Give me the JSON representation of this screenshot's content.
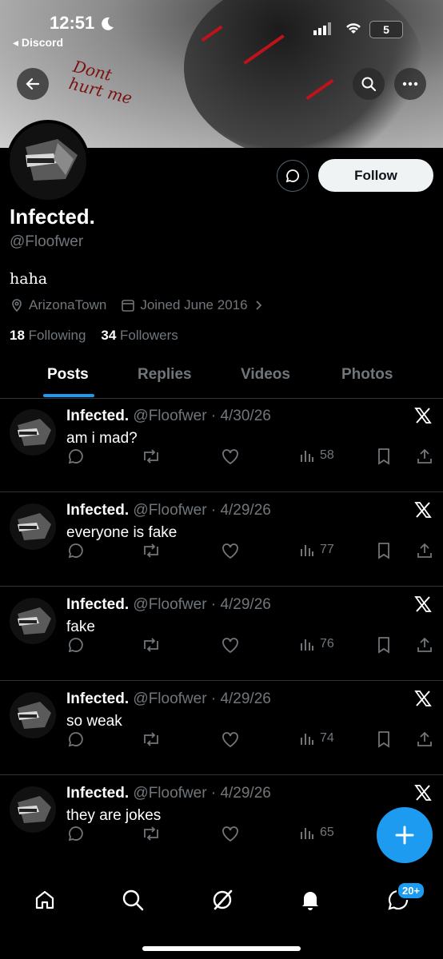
{
  "status_bar": {
    "time": "12:51",
    "back_app": "◂ Discord",
    "battery": "5"
  },
  "banner": {
    "caption": "Dont hurt me"
  },
  "profile": {
    "name": "Infected.",
    "handle": "@Floofwer",
    "bio": "haha",
    "location": "ArizonaTown",
    "joined": "Joined June 2016",
    "following_count": "18",
    "following_label": "Following",
    "followers_count": "34",
    "followers_label": "Followers",
    "follow_button": "Follow"
  },
  "tabs": [
    "Posts",
    "Replies",
    "Videos",
    "Photos"
  ],
  "active_tab": "Posts",
  "posts": [
    {
      "name": "Infected.",
      "handle": "@Floofwer",
      "date": "· 4/30/26",
      "text": "am i mad?",
      "views": "58"
    },
    {
      "name": "Infected.",
      "handle": "@Floofwer",
      "date": "· 4/29/26",
      "text": "everyone is fake",
      "views": "77"
    },
    {
      "name": "Infected.",
      "handle": "@Floofwer",
      "date": "· 4/29/26",
      "text": "fake",
      "views": "76"
    },
    {
      "name": "Infected.",
      "handle": "@Floofwer",
      "date": "· 4/29/26",
      "text": "so weak",
      "views": "74"
    },
    {
      "name": "Infected.",
      "handle": "@Floofwer",
      "date": "· 4/29/26",
      "text": "they are jokes",
      "views": "65"
    }
  ],
  "nav": {
    "messages_badge": "20+"
  },
  "colors": {
    "accent": "#1d9bf0",
    "background": "#000000",
    "muted": "#71767b"
  }
}
